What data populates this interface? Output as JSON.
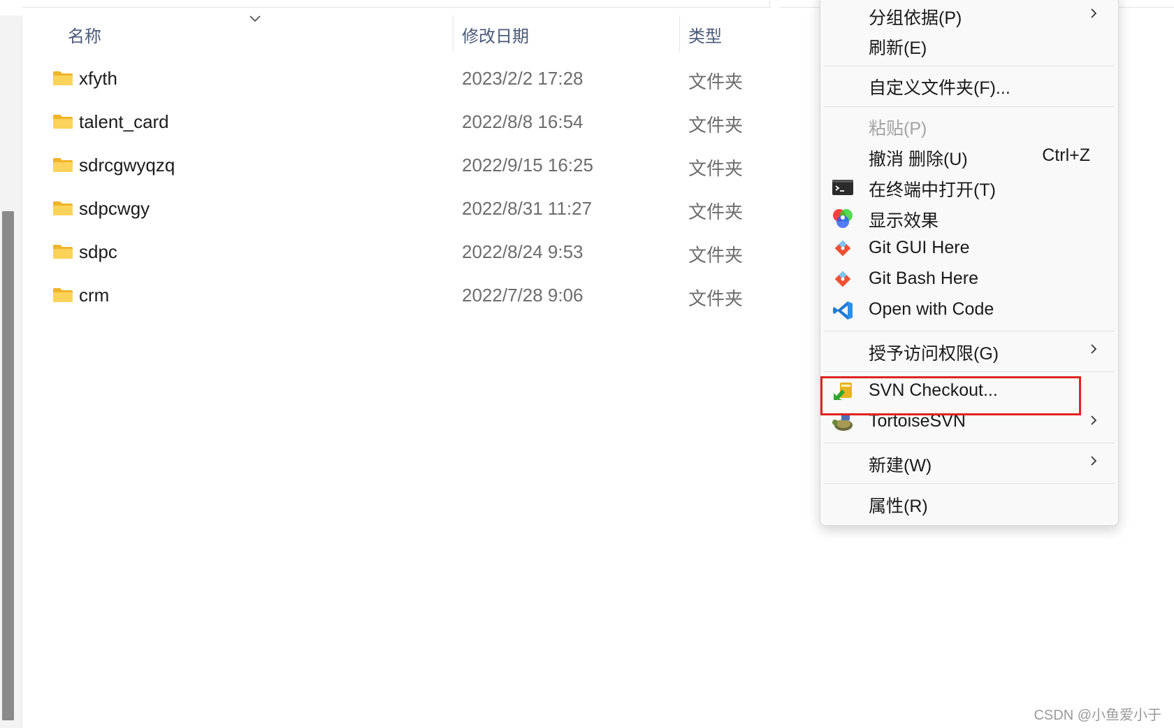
{
  "columns": {
    "name": "名称",
    "date": "修改日期",
    "type": "类型"
  },
  "files": [
    {
      "name": "xfyth",
      "date": "2023/2/2 17:28",
      "type": "文件夹"
    },
    {
      "name": "talent_card",
      "date": "2022/8/8 16:54",
      "type": "文件夹"
    },
    {
      "name": "sdrcgwyqzq",
      "date": "2022/9/15 16:25",
      "type": "文件夹"
    },
    {
      "name": "sdpcwgy",
      "date": "2022/8/31 11:27",
      "type": "文件夹"
    },
    {
      "name": "sdpc",
      "date": "2022/8/24 9:53",
      "type": "文件夹"
    },
    {
      "name": "crm",
      "date": "2022/7/28 9:06",
      "type": "文件夹"
    }
  ],
  "menu": {
    "group_by": "分组依据(P)",
    "refresh": "刷新(E)",
    "customize": "自定义文件夹(F)...",
    "paste": "粘贴(P)",
    "undo_delete": "撤消 删除(U)",
    "undo_shortcut": "Ctrl+Z",
    "open_terminal": "在终端中打开(T)",
    "display_effects": "显示效果",
    "git_gui": "Git GUI Here",
    "git_bash": "Git Bash Here",
    "open_code": "Open with Code",
    "grant_access": "授予访问权限(G)",
    "svn_checkout": "SVN Checkout...",
    "tortoise_svn": "TortoiseSVN",
    "new": "新建(W)",
    "properties": "属性(R)"
  },
  "colors": {
    "highlight": "#e0231f",
    "folder": "#f6c646"
  },
  "watermark": "CSDN @小鱼爱小于"
}
